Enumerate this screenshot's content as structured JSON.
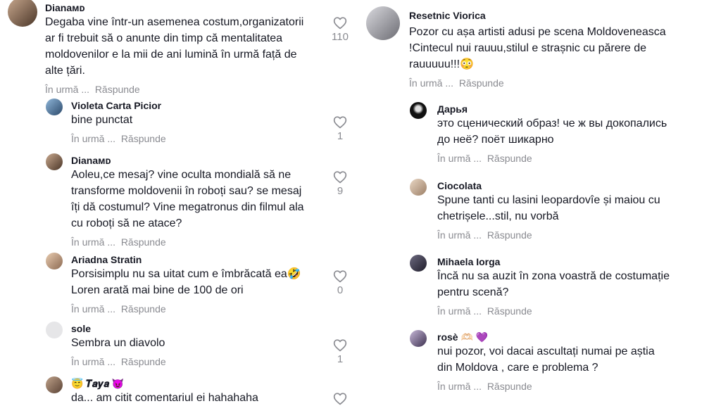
{
  "left": [
    {
      "user": "Dianaмᴅ",
      "lines": [
        "Degaba vine într-un asemenea costum,organizatorii",
        "ar fi trebuit să o anunte din timp că mentalitatea",
        "moldovenilor e la mii de ani lumină în urmă față de",
        "alte țări."
      ],
      "time": "În urmă ...",
      "reply": "Răspunde",
      "likes": "110"
    },
    {
      "user": "Violeta Carta Picior",
      "lines": [
        "bine punctat"
      ],
      "time": "În urmă ...",
      "reply": "Răspunde",
      "likes": "1"
    },
    {
      "user": "Dianaмᴅ",
      "lines": [
        "Aoleu,ce mesaj? vine oculta mondială să ne",
        "transforme moldovenii în roboți sau? se mesaj",
        "îți dă costumul? Vine megatronus din filmul ala",
        "cu roboți să ne atace?"
      ],
      "time": "În urmă ...",
      "reply": "Răspunde",
      "likes": "9"
    },
    {
      "user": "Ariadna Stratin",
      "lines": [
        "Porsisimplu nu sa uitat cum e îmbrăcată ea🤣",
        "Loren arată mai bine de 100 de ori"
      ],
      "time": "În urmă ...",
      "reply": "Răspunde",
      "likes": "0"
    },
    {
      "user": "sole",
      "lines": [
        "Sembra un diavolo"
      ],
      "time": "În urmă ...",
      "reply": "Răspunde",
      "likes": "1"
    },
    {
      "user": "😇 𝑻𝒂𝒚𝒂 😈",
      "lines": [
        "da... am citit comentariul ei hahahaha"
      ],
      "time": "",
      "reply": "",
      "likes": ""
    }
  ],
  "right": [
    {
      "user": "Resetnic Viorica",
      "lines": [
        "Pozor cu așa artisti adusi pe scena Moldoveneasca",
        "!Cintecul nui rauuu,stilul e strașnic cu părere de",
        "rauuuuu!!!😳"
      ],
      "time": "În urmă ...",
      "reply": "Răspunde"
    },
    {
      "user": "Дарья",
      "lines": [
        "это сценический образ! че ж вы докопались",
        "до неё? поёт шикарно"
      ],
      "time": "În urmă ...",
      "reply": "Răspunde"
    },
    {
      "user": "Ciocolata",
      "lines": [
        "Spune tanti cu lasini leopardovîe și maiou cu",
        "chetrișele...stil, nu vorbă"
      ],
      "time": "În urmă ...",
      "reply": "Răspunde"
    },
    {
      "user": "Mihaela Iorga",
      "lines": [
        "Încă nu sa auzit în zona voastră de costumație",
        "pentru scenă?"
      ],
      "time": "În urmă ...",
      "reply": "Răspunde"
    },
    {
      "user": "rosè 🫶🏻 💜",
      "lines": [
        "nui pozor, voi dacai ascultați numai pe aștia",
        "din Moldova , care e problema ?"
      ],
      "time": "În urmă ...",
      "reply": "Răspunde"
    }
  ],
  "colors": {
    "text": "#161823",
    "muted": "#8a8b91",
    "heart": "#8a8b91"
  },
  "icons": {
    "like": "heart-outline-icon"
  }
}
